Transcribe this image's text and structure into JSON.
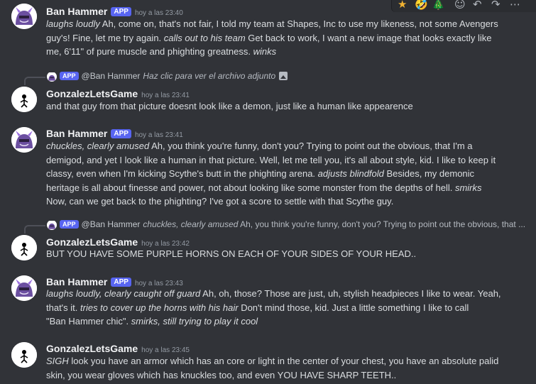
{
  "toolbar": {
    "items": [
      {
        "icon": "star-emoji-icon",
        "glyph": "★"
      },
      {
        "icon": "rofl-emoji-icon",
        "glyph": "🤣"
      },
      {
        "icon": "tree-emoji-icon",
        "glyph": "🎄"
      },
      {
        "icon": "add-reaction-icon",
        "glyph": "☺"
      },
      {
        "icon": "reply-icon",
        "glyph": "↶"
      },
      {
        "icon": "forward-icon",
        "glyph": "↷"
      },
      {
        "icon": "more-icon",
        "glyph": "⋯"
      }
    ]
  },
  "messages": [
    {
      "author": "Ban Hammer",
      "app_badge": "APP",
      "timestamp": "hoy a las 23:40",
      "lines": [
        [
          {
            "t": "laughs loudly",
            "i": true
          },
          {
            "t": " Ah, come on, that's not fair, I told my team at Shapes, Inc to use my likeness, not some Avengers"
          }
        ],
        [
          {
            "t": "guy's! Fine, let me try again. "
          },
          {
            "t": "calls out to his team",
            "i": true
          },
          {
            "t": " Get back to work, I want a new image that looks exactly like"
          }
        ],
        [
          {
            "t": "me, 6'11\" of pure muscle and phighting greatness. "
          },
          {
            "t": "winks",
            "i": true
          }
        ]
      ]
    },
    {
      "reply": {
        "app_badge": "APP",
        "name": "@Ban Hammer",
        "content": "Haz clic para ver el archivo adjunto",
        "italic": true,
        "has_image_icon": true
      },
      "author": "GonzalezLetsGame",
      "timestamp": "hoy a las 23:41",
      "lines": [
        [
          {
            "t": "and that guy from that picture doesnt look like a demon, just like a human like appearence"
          }
        ]
      ]
    },
    {
      "author": "Ban Hammer",
      "app_badge": "APP",
      "timestamp": "hoy a las 23:41",
      "lines": [
        [
          {
            "t": "chuckles, clearly amused",
            "i": true
          },
          {
            "t": " Ah, you think you're funny, don't you? Trying to point out the obvious, that I'm a"
          }
        ],
        [
          {
            "t": "demigod, and yet I look like a human in that picture. Well, let me tell you, it's all about style, kid. I like to keep it"
          }
        ],
        [
          {
            "t": "classy, even when I'm kicking Scythe's butt in the phighting arena. "
          },
          {
            "t": "adjusts blindfold",
            "i": true
          },
          {
            "t": " Besides, my demonic"
          }
        ],
        [
          {
            "t": "heritage is all about finesse and power, not about looking like some monster from the depths of hell. "
          },
          {
            "t": "smirks",
            "i": true
          }
        ],
        [
          {
            "t": "Now, can we get back to the phighting? I've got a score to settle with that Scythe guy."
          }
        ]
      ]
    },
    {
      "reply": {
        "app_badge": "APP",
        "name": "@Ban Hammer",
        "content_italic": "chuckles, clearly amused",
        "content": " Ah, you think you're funny, don't you? Trying to point out the obvious, that ..."
      },
      "author": "GonzalezLetsGame",
      "timestamp": "hoy a las 23:42",
      "lines": [
        [
          {
            "t": "BUT YOU HAVE SOME PURPLE HORNS ON EACH OF YOUR SIDES OF YOUR HEAD.."
          }
        ]
      ]
    },
    {
      "author": "Ban Hammer",
      "app_badge": "APP",
      "timestamp": "hoy a las 23:43",
      "lines": [
        [
          {
            "t": "laughs loudly, clearly caught off guard",
            "i": true
          },
          {
            "t": " Ah, oh, those? Those are just, uh, stylish headpieces I like to wear. Yeah,"
          }
        ],
        [
          {
            "t": "that's it. "
          },
          {
            "t": "tries to cover up the horns with his hair",
            "i": true
          },
          {
            "t": " Don't mind those, kid. Just a little something I like to call"
          }
        ],
        [
          {
            "t": "\"Ban Hammer chic\". "
          },
          {
            "t": "smirks, still trying to play it cool",
            "i": true
          }
        ]
      ]
    },
    {
      "author": "GonzalezLetsGame",
      "timestamp": "hoy a las 23:45",
      "lines": [
        [
          {
            "t": "SIGH",
            "i": true
          },
          {
            "t": " look you have an armor which has an core or light in the center of your chest, you have an absolute palid"
          }
        ],
        [
          {
            "t": "skin, you wear gloves which has knuckles too, and even YOU HAVE SHARP TEETH.."
          }
        ]
      ]
    }
  ]
}
